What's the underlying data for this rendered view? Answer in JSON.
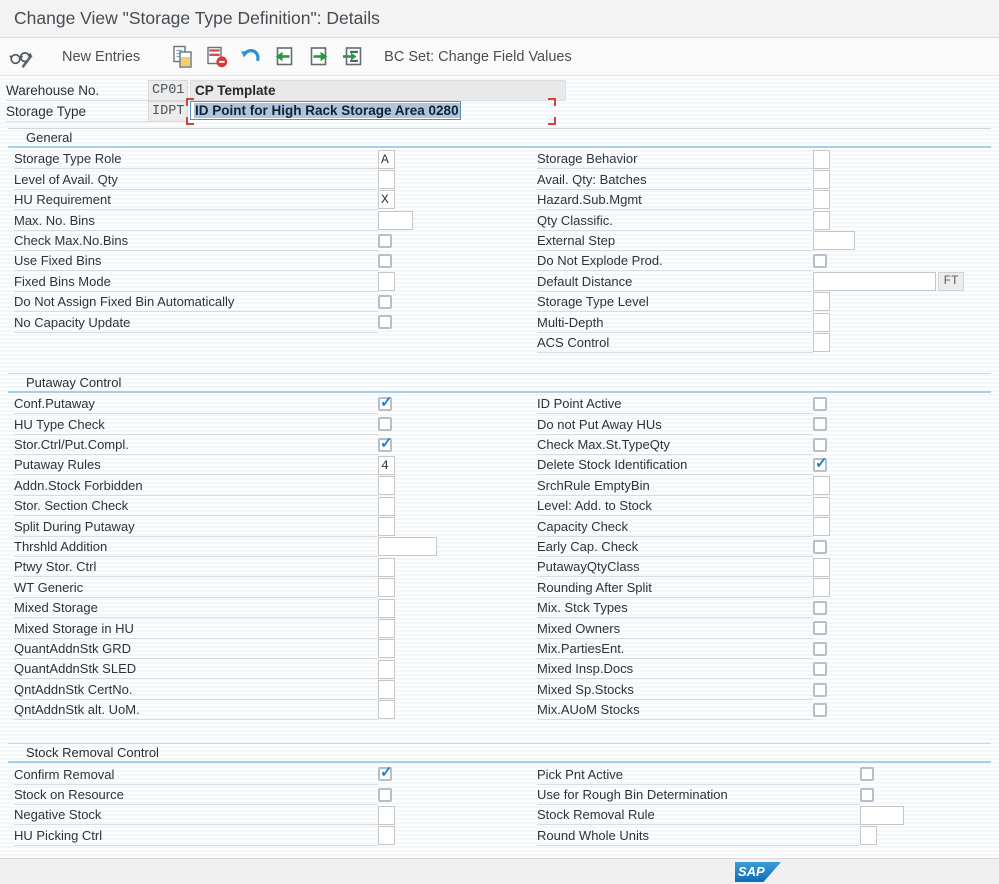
{
  "title": "Change View \"Storage Type Definition\": Details",
  "toolbar": {
    "new_entries": "New Entries",
    "bc_set": "BC Set: Change Field Values",
    "icons": [
      "display-change-icon",
      "copy-icon",
      "delete-icon",
      "undo-icon",
      "previous-entry-icon",
      "next-entry-icon",
      "select-entries-icon"
    ]
  },
  "header_fields": {
    "warehouse": {
      "label": "Warehouse No.",
      "code": "CP01",
      "description": "CP Template"
    },
    "storage_type": {
      "label": "Storage Type",
      "code": "IDPT",
      "description": "ID Point for High Rack Storage Area 0280",
      "focused": true,
      "text_selected": true
    }
  },
  "sections": [
    {
      "title": "General",
      "left": [
        {
          "label": "Storage Type Role",
          "type": "char",
          "value": "A"
        },
        {
          "label": "Level of Avail. Qty",
          "type": "char",
          "value": ""
        },
        {
          "label": "HU Requirement",
          "type": "char",
          "value": "X"
        },
        {
          "label": "Max. No. Bins",
          "type": "input",
          "value": "",
          "w": 31
        },
        {
          "label": "Check Max.No.Bins",
          "type": "checkbox",
          "checked": false
        },
        {
          "label": "Use Fixed Bins",
          "type": "checkbox",
          "checked": false
        },
        {
          "label": "Fixed Bins Mode",
          "type": "char",
          "value": ""
        },
        {
          "label": "Do Not Assign Fixed Bin Automatically",
          "type": "checkbox",
          "checked": false
        },
        {
          "label": "No Capacity Update",
          "type": "checkbox",
          "checked": false
        }
      ],
      "right": [
        {
          "label": "Storage Behavior",
          "type": "char",
          "value": ""
        },
        {
          "label": "Avail. Qty: Batches",
          "type": "char",
          "value": ""
        },
        {
          "label": "Hazard.Sub.Mgmt",
          "type": "char",
          "value": ""
        },
        {
          "label": "Qty Classific.",
          "type": "char",
          "value": ""
        },
        {
          "label": "External Step",
          "type": "input",
          "value": "",
          "w": 38
        },
        {
          "label": "Do Not Explode Prod.",
          "type": "checkbox",
          "checked": false
        },
        {
          "label": "Default Distance",
          "type": "unit",
          "value": "",
          "unit": "FT",
          "w": 119
        },
        {
          "label": "Storage Type Level",
          "type": "char",
          "value": ""
        },
        {
          "label": "Multi-Depth",
          "type": "char",
          "value": ""
        },
        {
          "label": "ACS Control",
          "type": "char",
          "value": ""
        }
      ]
    },
    {
      "title": "Putaway Control",
      "left": [
        {
          "label": "Conf.Putaway",
          "type": "checkbox",
          "checked": true
        },
        {
          "label": "HU Type Check",
          "type": "checkbox",
          "checked": false
        },
        {
          "label": "Stor.Ctrl/Put.Compl.",
          "type": "checkbox",
          "checked": true
        },
        {
          "label": "Putaway Rules",
          "type": "char",
          "value": "4"
        },
        {
          "label": "Addn.Stock Forbidden",
          "type": "char",
          "value": ""
        },
        {
          "label": "Stor. Section Check",
          "type": "char",
          "value": ""
        },
        {
          "label": "Split During Putaway",
          "type": "char",
          "value": ""
        },
        {
          "label": "Thrshld Addition",
          "type": "input",
          "value": "",
          "w": 55
        },
        {
          "label": "Ptwy Stor. Ctrl",
          "type": "char",
          "value": ""
        },
        {
          "label": "WT Generic",
          "type": "char",
          "value": ""
        },
        {
          "label": "Mixed Storage",
          "type": "char",
          "value": ""
        },
        {
          "label": "Mixed Storage in HU",
          "type": "char",
          "value": ""
        },
        {
          "label": "QuantAddnStk GRD",
          "type": "char",
          "value": ""
        },
        {
          "label": "QuantAddnStk SLED",
          "type": "char",
          "value": ""
        },
        {
          "label": "QntAddnStk CertNo.",
          "type": "char",
          "value": ""
        },
        {
          "label": "QntAddnStk alt. UoM.",
          "type": "char",
          "value": ""
        }
      ],
      "right": [
        {
          "label": "ID Point Active",
          "type": "checkbox",
          "checked": false
        },
        {
          "label": "Do not Put Away HUs",
          "type": "checkbox",
          "checked": false
        },
        {
          "label": "Check Max.St.TypeQty",
          "type": "checkbox",
          "checked": false
        },
        {
          "label": "Delete Stock Identification",
          "type": "checkbox",
          "checked": true
        },
        {
          "label": "SrchRule EmptyBin",
          "type": "char",
          "value": ""
        },
        {
          "label": "Level: Add. to Stock",
          "type": "char",
          "value": ""
        },
        {
          "label": "Capacity Check",
          "type": "char",
          "value": ""
        },
        {
          "label": "Early Cap. Check",
          "type": "checkbox",
          "checked": false
        },
        {
          "label": "PutawayQtyClass",
          "type": "char",
          "value": ""
        },
        {
          "label": "Rounding After Split",
          "type": "char",
          "value": ""
        },
        {
          "label": "Mix. Stck Types",
          "type": "checkbox",
          "checked": false
        },
        {
          "label": "Mixed Owners",
          "type": "checkbox",
          "checked": false
        },
        {
          "label": "Mix.PartiesEnt.",
          "type": "checkbox",
          "checked": false
        },
        {
          "label": "Mixed Insp.Docs",
          "type": "checkbox",
          "checked": false
        },
        {
          "label": "Mixed Sp.Stocks",
          "type": "checkbox",
          "checked": false
        },
        {
          "label": "Mix.AUoM Stocks",
          "type": "checkbox",
          "checked": false
        }
      ]
    },
    {
      "title": "Stock Removal Control",
      "left": [
        {
          "label": "Confirm Removal",
          "type": "checkbox",
          "checked": true
        },
        {
          "label": "Stock on Resource",
          "type": "checkbox",
          "checked": false
        },
        {
          "label": "Negative Stock",
          "type": "char",
          "value": ""
        },
        {
          "label": "HU Picking Ctrl",
          "type": "char",
          "value": ""
        }
      ],
      "right": [
        {
          "label": "Pick Pnt Active",
          "type": "checkbox",
          "checked": false
        },
        {
          "label": "Use for Rough Bin Determination",
          "type": "checkbox",
          "checked": false
        },
        {
          "label": "Stock Removal Rule",
          "type": "input",
          "value": "",
          "w": 40
        },
        {
          "label": "Round Whole Units",
          "type": "char",
          "value": ""
        }
      ]
    }
  ],
  "footer": {
    "logo_text": "SAP"
  },
  "colors": {
    "section_underline": "#a6cfeb",
    "check_blue": "#1d7fd0",
    "selection_blue": "#aec5dc",
    "focus_red": "#d84040",
    "arrow_green": "#259a3f",
    "delete_red": "#d23a3a",
    "undo_blue": "#2e8fd5",
    "logo_blue": "#0e6db6"
  }
}
